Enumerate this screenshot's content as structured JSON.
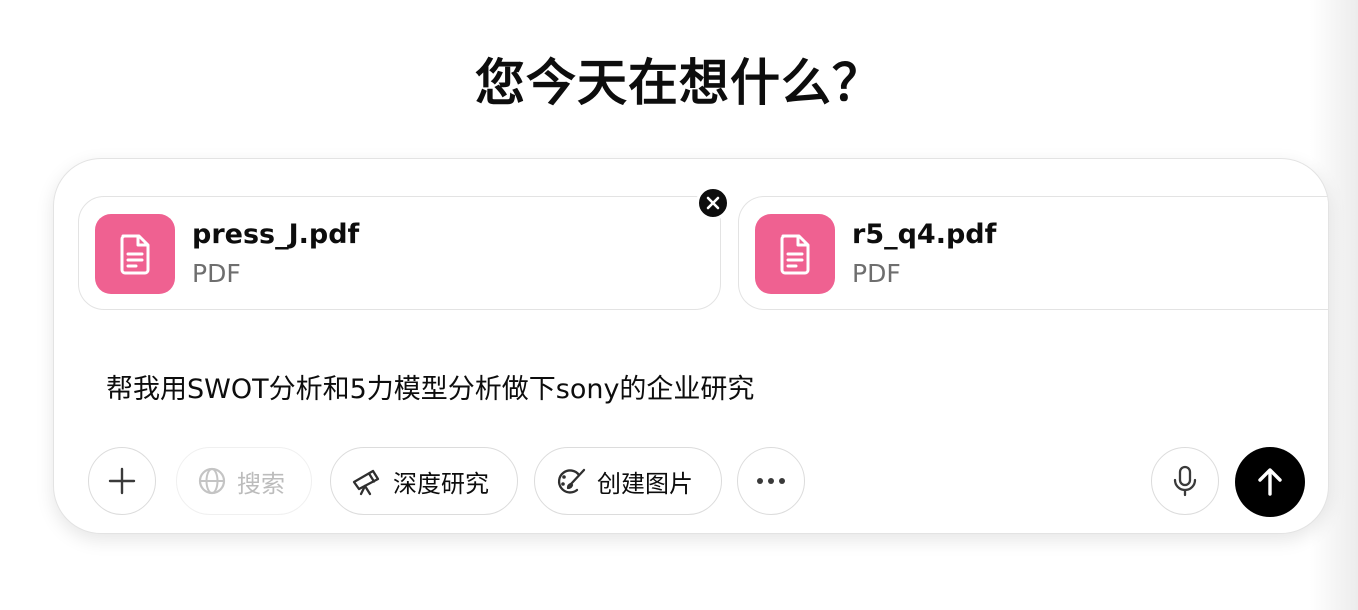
{
  "heading": "您今天在想什么？",
  "attachments": [
    {
      "name": "press_J.pdf",
      "type": "PDF",
      "icon": "document-icon",
      "color": "#ef6191"
    },
    {
      "name": "r5_q4.pdf",
      "type": "PDF",
      "icon": "document-icon",
      "color": "#ef6191"
    }
  ],
  "prompt": "帮我用SWOT分析和5力模型分析做下sony的企业研究",
  "toolbar": {
    "add_icon": "plus-icon",
    "search_label": "搜索",
    "search_icon": "globe-icon",
    "deep_research_label": "深度研究",
    "deep_research_icon": "telescope-icon",
    "create_image_label": "创建图片",
    "create_image_icon": "palette-icon",
    "more_icon": "more-icon",
    "voice_icon": "microphone-icon",
    "send_icon": "arrow-up-icon"
  },
  "colors": {
    "file_icon_bg": "#ef6191",
    "send_bg": "#000000",
    "disabled_text": "#bcbcbc"
  }
}
